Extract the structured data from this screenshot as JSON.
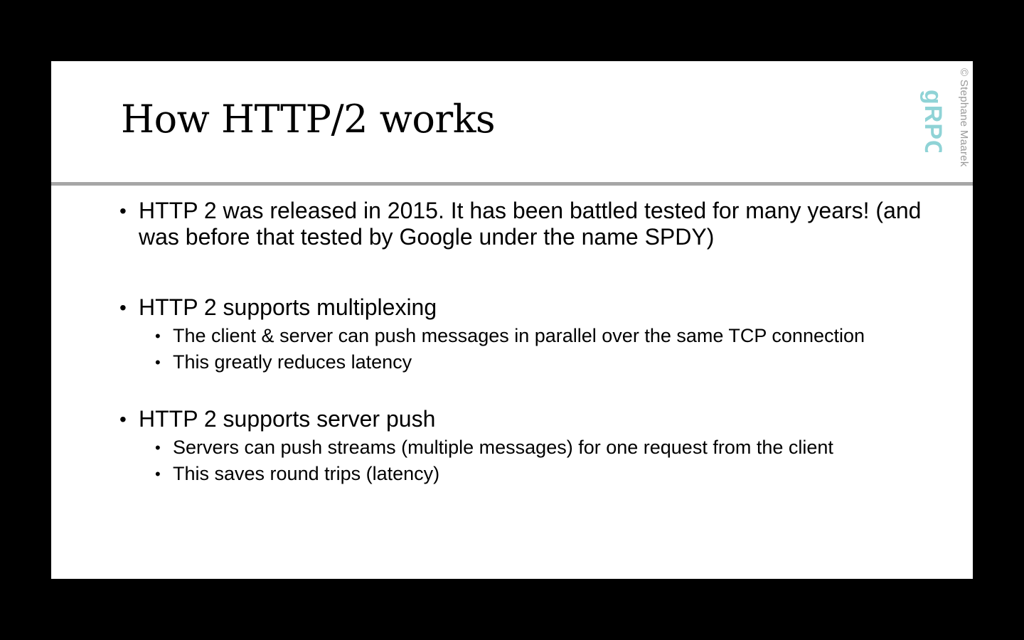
{
  "slide": {
    "title": "How HTTP/2 works",
    "watermark": {
      "copyright": "© Stephane Maarek",
      "logo_text": "gRPC",
      "logo_color": "#8fd3d6"
    },
    "bullets": [
      {
        "text": "HTTP 2 was released in 2015. It has been battled tested for many years! (and was before that tested by Google under the name SPDY)",
        "sub": []
      },
      {
        "text": "HTTP 2 supports multiplexing",
        "sub": [
          "The client & server can push messages in parallel over the same TCP connection",
          "This greatly reduces latency"
        ]
      },
      {
        "text": "HTTP 2 supports server push",
        "sub": [
          "Servers can push streams (multiple messages) for one request from the client",
          "This saves round trips (latency)"
        ]
      }
    ],
    "bullet_glyph": "•"
  }
}
